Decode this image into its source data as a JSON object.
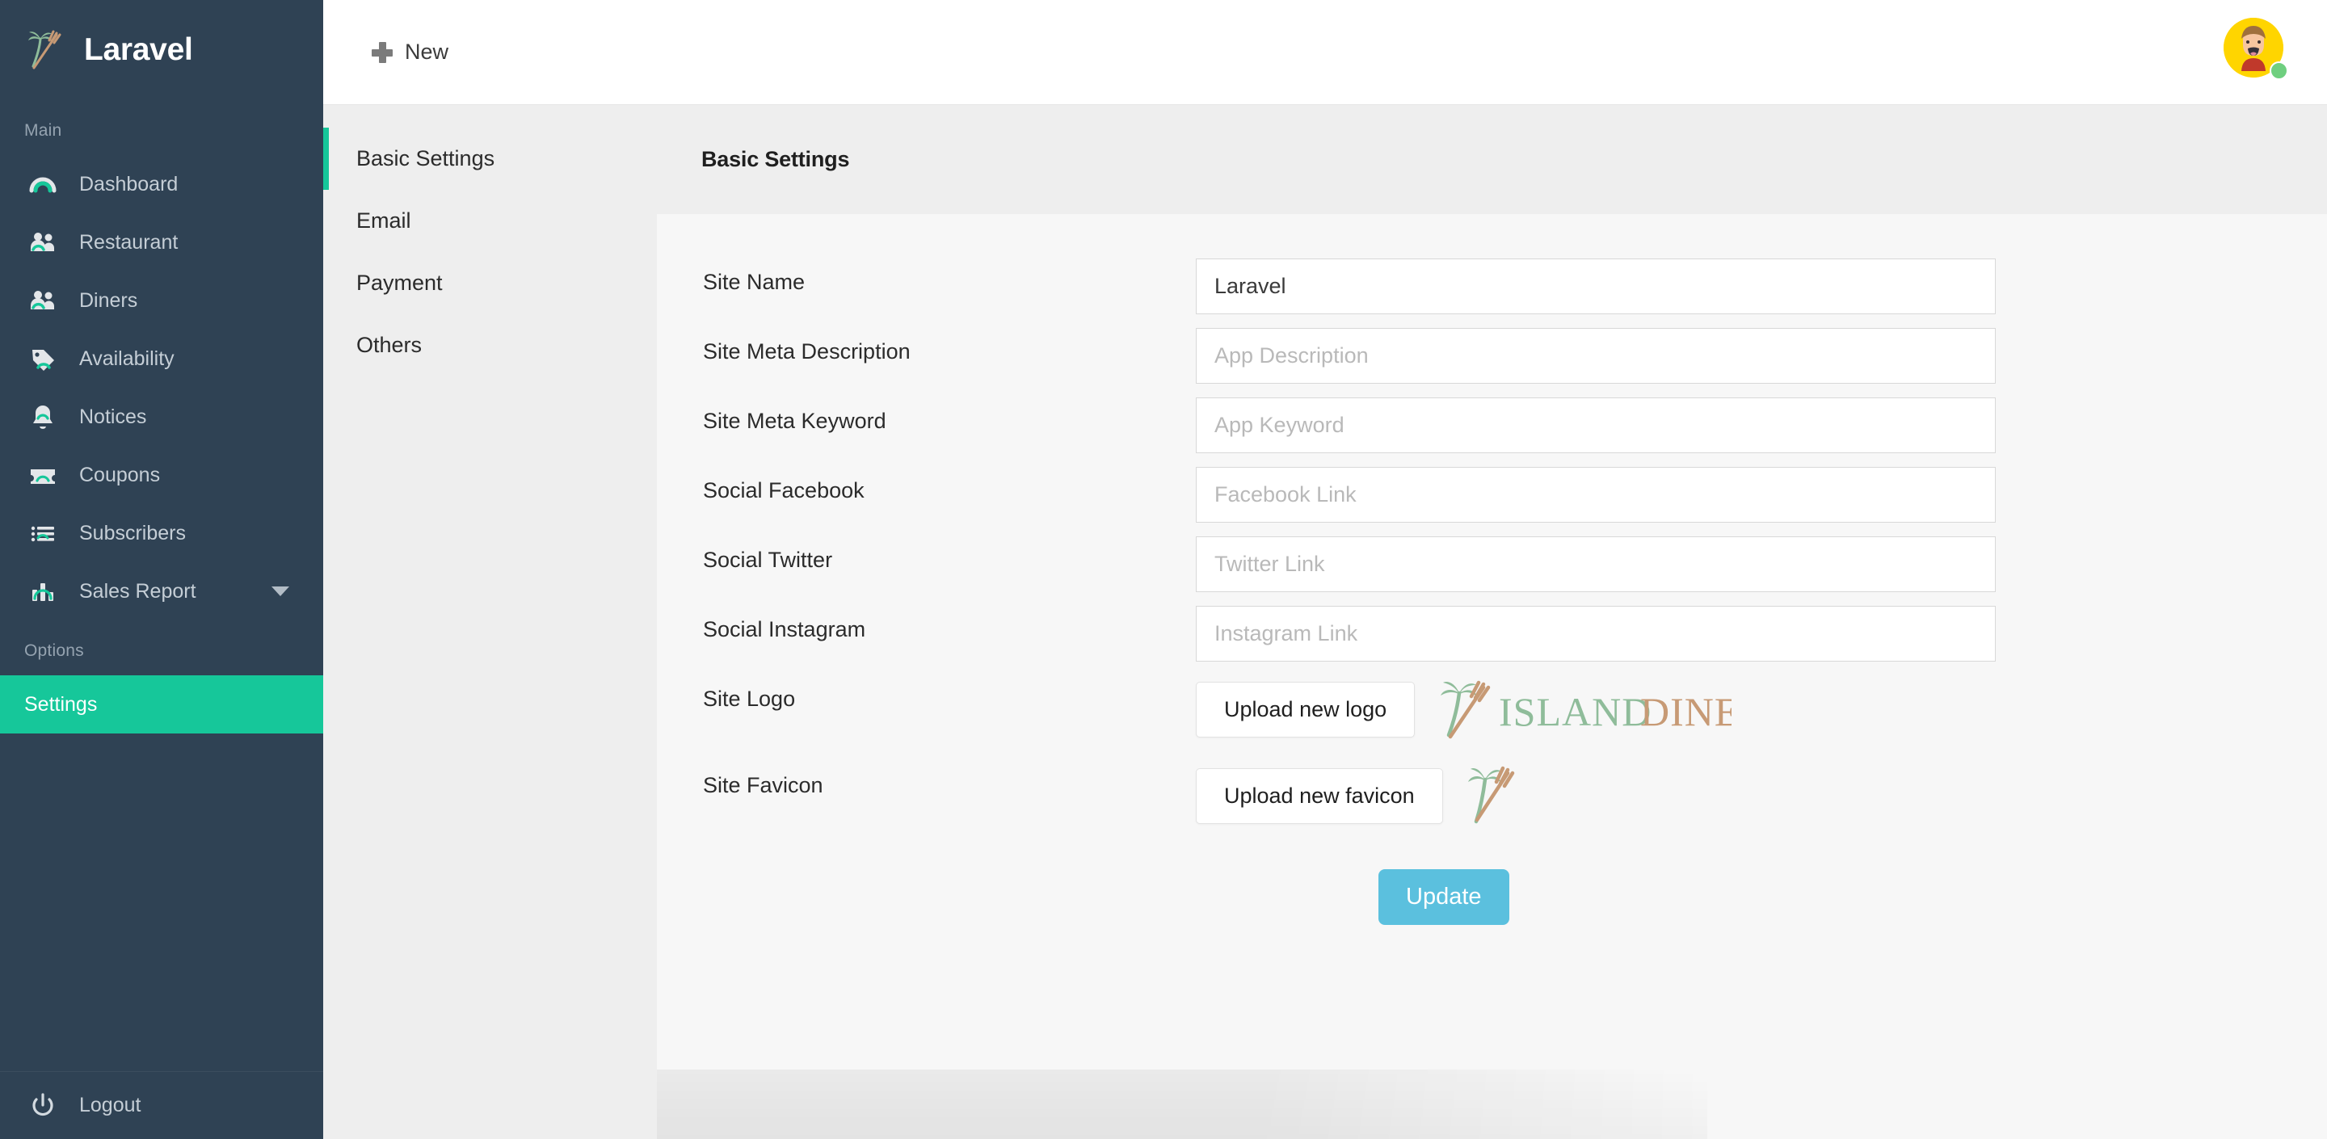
{
  "brand": {
    "title": "Laravel",
    "logo_icon": "palm-fork-logo-icon"
  },
  "sidebar": {
    "sections": [
      {
        "label": "Main",
        "items": [
          {
            "label": "Dashboard",
            "icon": "gauge-icon"
          },
          {
            "label": "Restaurant",
            "icon": "people-group-icon"
          },
          {
            "label": "Diners",
            "icon": "people-group-icon"
          },
          {
            "label": "Availability",
            "icon": "tag-icon"
          },
          {
            "label": "Notices",
            "icon": "bell-icon"
          },
          {
            "label": "Coupons",
            "icon": "ticket-icon"
          },
          {
            "label": "Subscribers",
            "icon": "list-icon"
          },
          {
            "label": "Sales Report",
            "icon": "bar-chart-icon",
            "has_caret": true
          }
        ]
      },
      {
        "label": "Options",
        "items": [
          {
            "label": "Settings",
            "icon": "none",
            "active": true
          }
        ]
      }
    ],
    "logout": {
      "label": "Logout",
      "icon": "power-icon"
    },
    "active_color": "#16c79a"
  },
  "topbar": {
    "new_label": "New",
    "new_icon": "plus-icon",
    "avatar": {
      "name": "user-avatar",
      "status": "online",
      "bg_color": "#ffd500",
      "status_color": "#6fcf7f"
    }
  },
  "subnav": {
    "items": [
      {
        "label": "Basic Settings",
        "active": true
      },
      {
        "label": "Email",
        "active": false
      },
      {
        "label": "Payment",
        "active": false
      },
      {
        "label": "Others",
        "active": false
      }
    ]
  },
  "main": {
    "card_title": "Basic Settings",
    "fields": [
      {
        "label": "Site Name",
        "value": "Laravel",
        "placeholder": ""
      },
      {
        "label": "Site Meta Description",
        "value": "",
        "placeholder": "App Description"
      },
      {
        "label": "Site Meta Keyword",
        "value": "",
        "placeholder": "App Keyword"
      },
      {
        "label": "Social Facebook",
        "value": "",
        "placeholder": "Facebook Link"
      },
      {
        "label": "Social Twitter",
        "value": "",
        "placeholder": "Twitter Link"
      },
      {
        "label": "Social Instagram",
        "value": "",
        "placeholder": "Instagram Link"
      }
    ],
    "logo_row": {
      "label": "Site Logo",
      "button": "Upload new logo",
      "preview_text_1": "ISLAND",
      "preview_text_2": "DINE"
    },
    "favicon_row": {
      "label": "Site Favicon",
      "button": "Upload new favicon"
    },
    "submit": {
      "label": "Update",
      "color": "#5bc0de"
    }
  },
  "colors": {
    "sidebar_bg": "#2f4254",
    "accent_teal": "#16c79a",
    "logo_green": "#8fbc9a",
    "logo_tan": "#c79a75",
    "card_bg": "#f7f7f7",
    "page_bg": "#eeeeee"
  }
}
